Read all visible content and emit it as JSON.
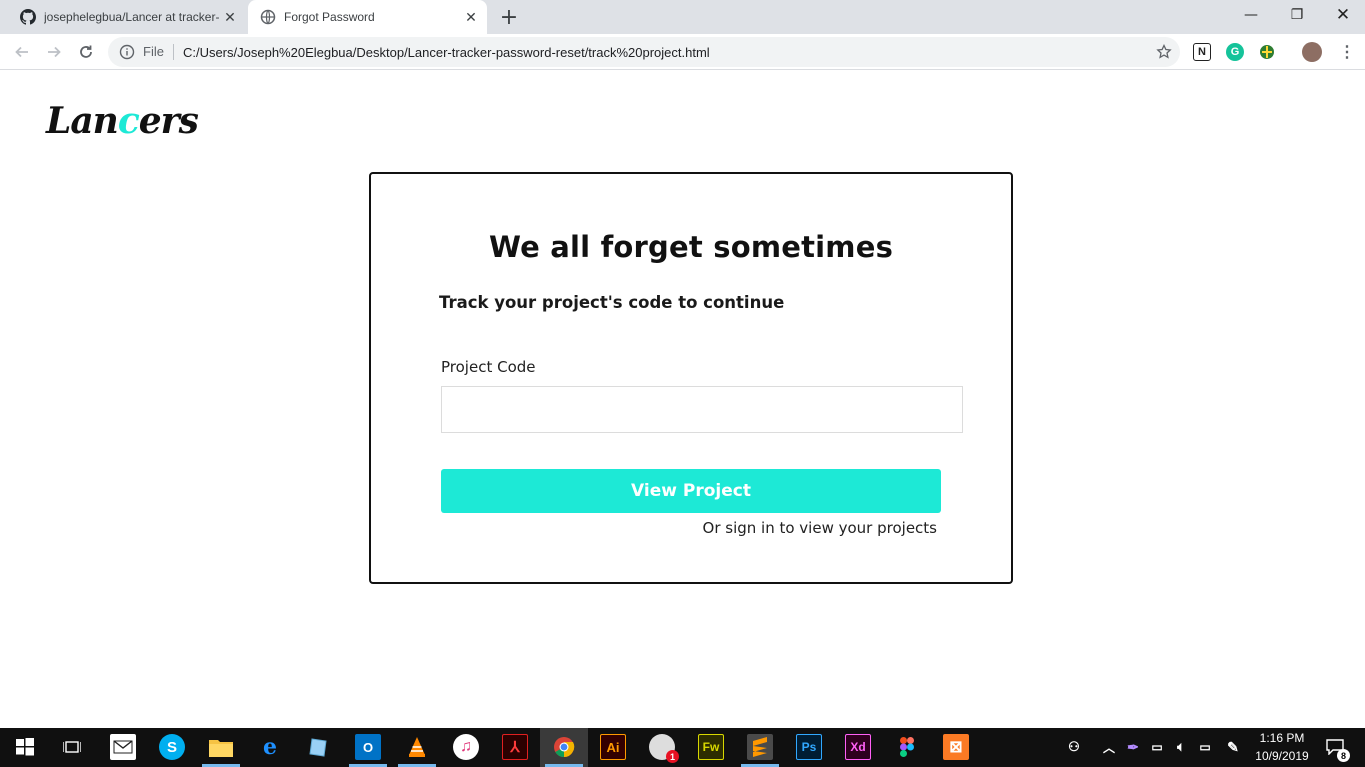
{
  "browser": {
    "tabs": [
      {
        "title": "josephelegbua/Lancer at tracker-",
        "icon": "github-icon",
        "active": false
      },
      {
        "title": "Forgot Password",
        "icon": "globe-icon",
        "active": true
      }
    ],
    "new_tab_label": "+",
    "address": {
      "scheme_label": "File",
      "url": "C:/Users/Joseph%20Elegbua/Desktop/Lancer-tracker-password-reset/track%20project.html"
    },
    "extensions": [
      "notion-icon",
      "grammarly-icon",
      "vpn-icon",
      "profile-avatar"
    ]
  },
  "page": {
    "logo": {
      "pre": "Lan",
      "accent": "c",
      "post": "ers",
      "accent_color": "#1de9d6"
    },
    "card": {
      "title": "We all forget sometimes",
      "subtitle": "Track your project's code to continue",
      "field_label": "Project Code",
      "field_value": "",
      "button_label": "View Project",
      "signin_link": "Or sign in to view your projects"
    }
  },
  "taskbar": {
    "apps": [
      "windows-start-icon",
      "task-view-icon",
      "mail-icon",
      "skype-icon",
      "file-explorer-icon",
      "edge-icon",
      "notepad-icon",
      "outlook-icon",
      "vlc-icon",
      "itunes-icon",
      "acrobat-icon",
      "chrome-icon",
      "illustrator-icon",
      "browser-badge-icon",
      "fireworks-icon",
      "sublime-icon",
      "photoshop-icon",
      "xd-icon",
      "figma-icon",
      "xampp-icon"
    ],
    "app_labels": {
      "illustrator": "Ai",
      "fireworks": "Fw",
      "photoshop": "Ps",
      "xd": "Xd",
      "outlook": "O"
    },
    "badge_count": "1",
    "notification_count": "8",
    "clock": {
      "time": "1:16 PM",
      "date": "10/9/2019"
    }
  }
}
